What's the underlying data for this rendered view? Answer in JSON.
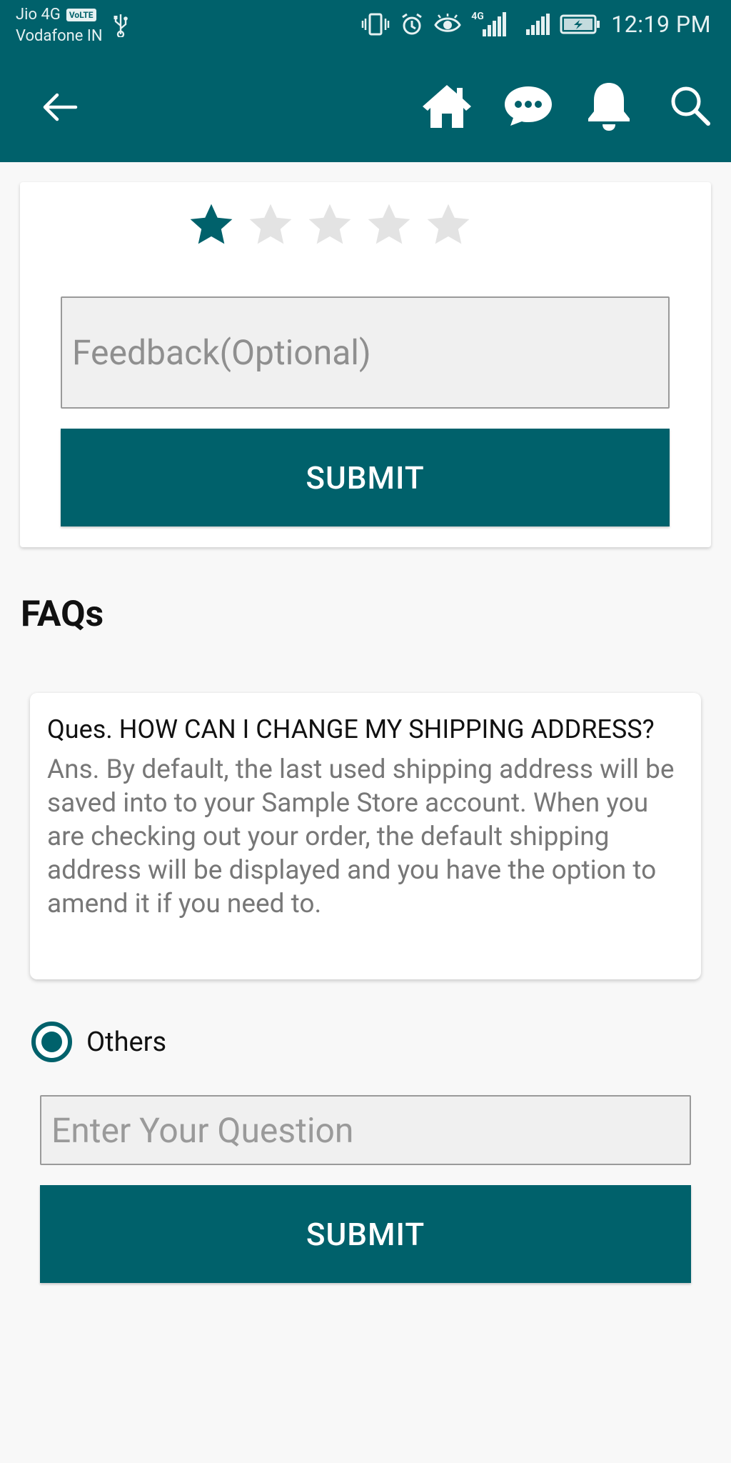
{
  "status_bar": {
    "carrier_1": "Jio 4G",
    "volte": "VoLTE",
    "carrier_2": "Vodafone IN",
    "network_label": "4G",
    "time": "12:19 PM"
  },
  "app_bar": {
    "icons": [
      "back-arrow-icon",
      "home-icon",
      "chat-icon",
      "bell-icon",
      "search-icon"
    ]
  },
  "rating": {
    "value": 1,
    "max": 5,
    "feedback_placeholder": "Feedback(Optional)",
    "submit_label": "SUBMIT"
  },
  "faqs": {
    "title": "FAQs",
    "items": [
      {
        "question": "Ques. HOW CAN I CHANGE MY SHIPPING ADDRESS?",
        "answer": "Ans. By default, the last used shipping address will be saved into to your Sample Store account. When you are checking out your order, the default shipping address will be displayed and you have the option to amend it if you need to."
      }
    ],
    "others_label": "Others",
    "question_placeholder": "Enter Your Question",
    "submit_label": "SUBMIT"
  },
  "colors": {
    "primary": "#00616b",
    "star_empty": "#e3e3e3",
    "background": "#f8f8f8"
  }
}
